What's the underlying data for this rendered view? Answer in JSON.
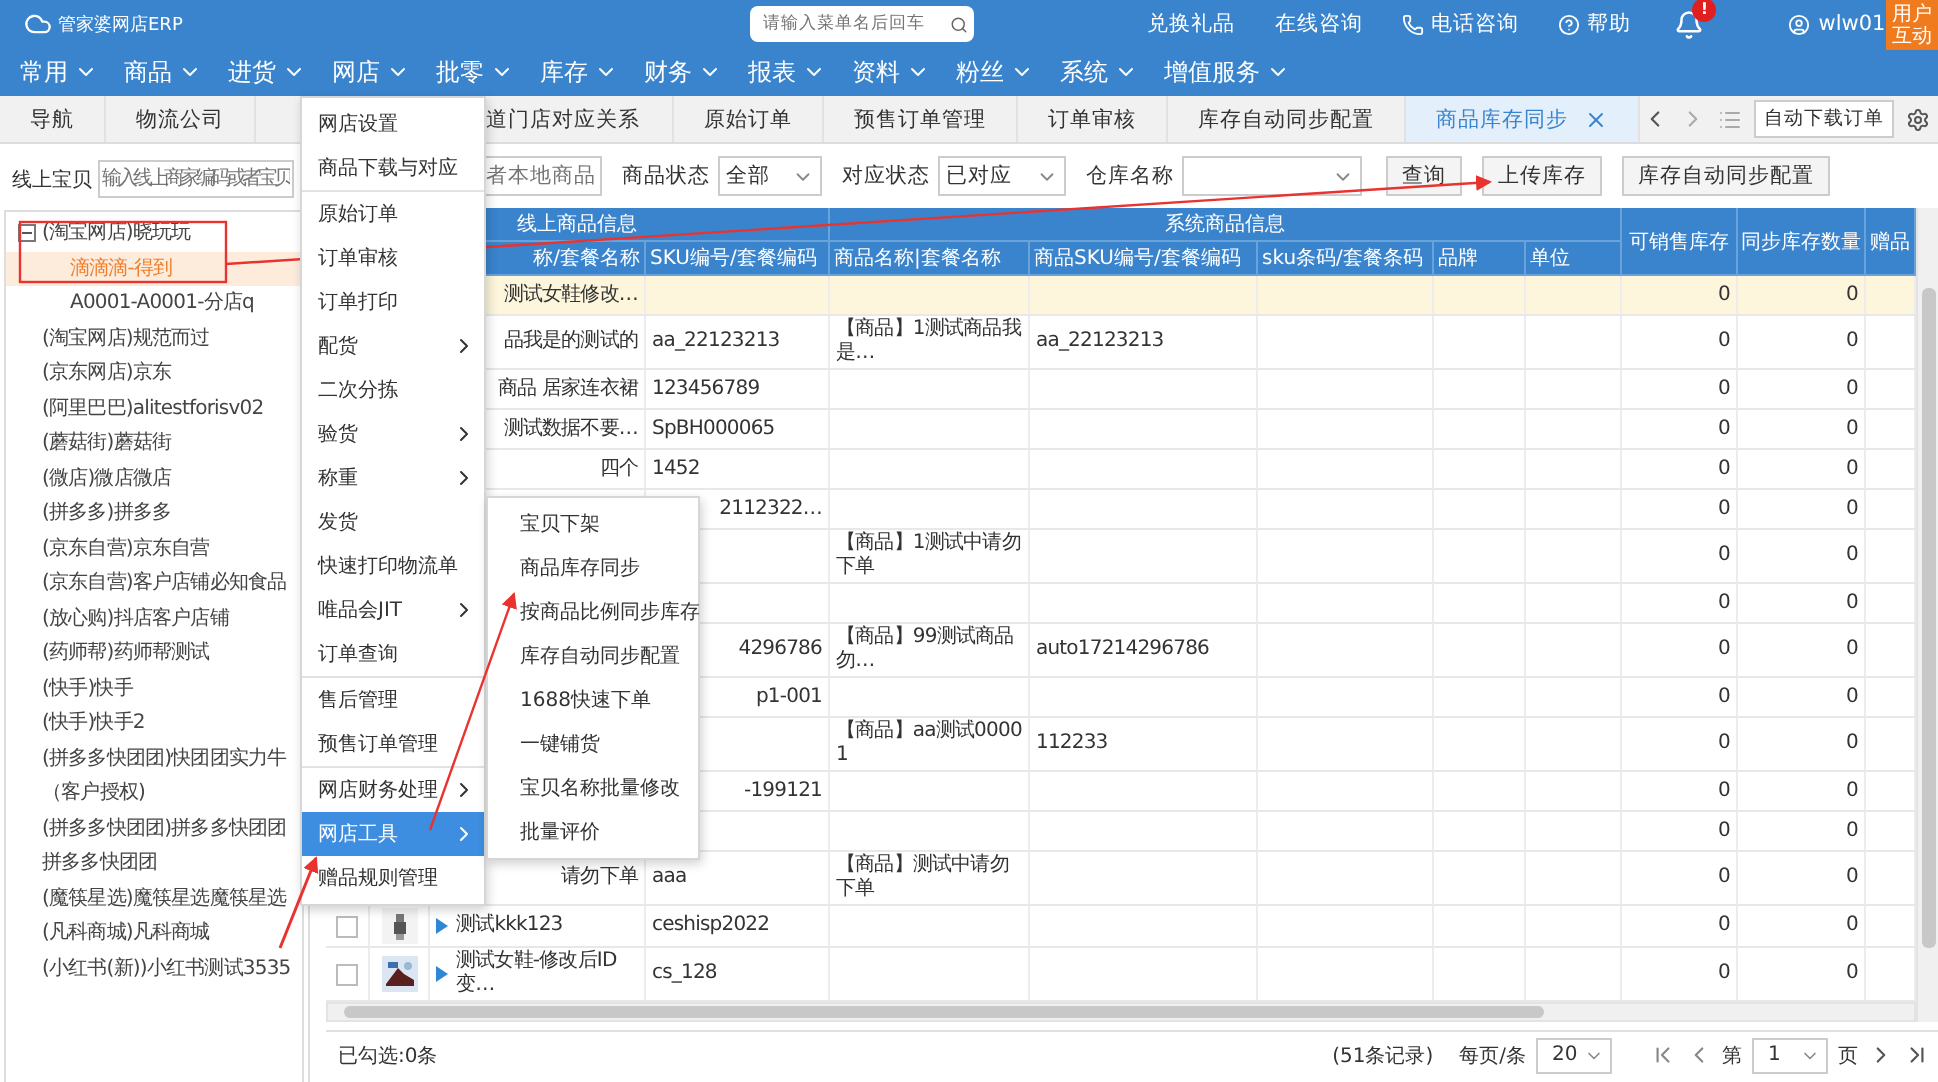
{
  "header": {
    "logo": "管家婆网店ERP",
    "search": {
      "placeholder": "请输入菜单名后回车"
    },
    "links": [
      {
        "kind": "plain",
        "label": "兑换礼品"
      },
      {
        "kind": "plain",
        "label": "在线咨询"
      },
      {
        "kind": "phone",
        "label": "电话咨询"
      },
      {
        "kind": "help",
        "label": "帮助"
      }
    ],
    "notification_badge": "!",
    "user": "wlw01",
    "feedback_button": "用户互动"
  },
  "nav": [
    "常用",
    "商品",
    "进货",
    "网店",
    "批零",
    "库存",
    "财务",
    "报表",
    "资料",
    "粉丝",
    "系统",
    "增值服务"
  ],
  "tabs": [
    {
      "label": "导航",
      "selected": false
    },
    {
      "label": "物流公司",
      "selected": false
    },
    {
      "label": "道门店对应关系",
      "selected": false,
      "clipped": true
    },
    {
      "label": "原始订单",
      "selected": false
    },
    {
      "label": "预售订单管理",
      "selected": false
    },
    {
      "label": "订单审核",
      "selected": false
    },
    {
      "label": "库存自动同步配置",
      "selected": false
    },
    {
      "label": "商品库存同步",
      "selected": true
    }
  ],
  "tab_tools": {
    "auto_download_button": "自动下载订单"
  },
  "left_panel": {
    "label": "线上宝贝",
    "search_placeholder": "输入线上商家编码或者宝贝",
    "tree": [
      {
        "label": "(淘宝网店)晓玩玩",
        "expanded": true,
        "selected": false,
        "children": [
          {
            "label": "滴滴滴-得到",
            "selected": true
          },
          {
            "label": "A0001-A0001-分店q",
            "selected": false
          }
        ]
      },
      {
        "label": "(淘宝网店)规范而过",
        "selected": false
      },
      {
        "label": "(京东网店)京东",
        "selected": false
      },
      {
        "label": "(阿里巴巴)alitestforisv02",
        "selected": false
      },
      {
        "label": "(蘑菇街)蘑菇街",
        "selected": false
      },
      {
        "label": "(微店)微店微店",
        "selected": false
      },
      {
        "label": "(拼多多)拼多多",
        "selected": false
      },
      {
        "label": "(京东自营)京东自营",
        "selected": false
      },
      {
        "label": "(京东自营)客户店铺必知食品",
        "selected": false
      },
      {
        "label": "(放心购)抖店客户店铺",
        "selected": false
      },
      {
        "label": "(药师帮)药师帮测试",
        "selected": false
      },
      {
        "label": "(快手)快手",
        "selected": false
      },
      {
        "label": "(快手)快手2",
        "selected": false
      },
      {
        "label": "(拼多多快团团)快团团实力牛（客户授权)",
        "selected": false
      },
      {
        "label": "(拼多多快团团)拼多多快团团拼多多快团团",
        "selected": false
      },
      {
        "label": "(魔筷星选)魔筷星选魔筷星选",
        "selected": false
      },
      {
        "label": "(凡科商城)凡科商城",
        "selected": false
      },
      {
        "label": "(小红书(新))小红书测试3535",
        "selected": false
      }
    ]
  },
  "filters": {
    "search_placeholder": "者本地商品",
    "selects": [
      {
        "label": "商品状态",
        "value": "全部"
      },
      {
        "label": "对应状态",
        "value": "已对应"
      },
      {
        "label": "仓库名称"
      }
    ],
    "buttons": [
      "查询",
      "上传库存",
      "库存自动同步配置"
    ]
  },
  "table": {
    "online_group": {
      "label": "线上商品信息",
      "columns": [
        {
          "label": "称/套餐名称",
          "clipped": true
        },
        {
          "label": "SKU编号/套餐编码"
        }
      ]
    },
    "system_group": {
      "label": "系统商品信息",
      "columns": [
        "商品名称|套餐名称",
        "商品SKU编号/套餐编码",
        "sku条码/套餐条码",
        "品牌",
        "单位"
      ]
    },
    "stock_columns": [
      "可销售库存",
      "同步库存数量",
      "赠品"
    ],
    "rows": [
      {
        "selected": true,
        "name": {
          "text": "测试女鞋修改…",
          "clipped": true
        },
        "sellable": "0",
        "sync": "0"
      },
      {
        "selected": false,
        "name": {
          "text": "品我是的测试的",
          "clipped": true
        },
        "sku": {
          "text": "aa_22123213"
        },
        "sys_name": "【商品】1测试商品我是…",
        "sys_sku": "aa_22123213",
        "sellable": "0",
        "sync": "0"
      },
      {
        "selected": false,
        "name": {
          "text": "商品 居家连衣裙",
          "clipped": true
        },
        "sku": {
          "text": "123456789"
        },
        "sellable": "0",
        "sync": "0"
      },
      {
        "selected": false,
        "name": {
          "text": "测试数据不要…",
          "clipped": true
        },
        "sku": {
          "text": "SpBH000065"
        },
        "sellable": "0",
        "sync": "0"
      },
      {
        "selected": false,
        "name": {
          "text": "四个",
          "clipped": true
        },
        "sku": {
          "text": "1452"
        },
        "sellable": "0",
        "sync": "0"
      },
      {
        "selected": false,
        "sku": {
          "text": "2112322…",
          "clipped": true
        },
        "sellable": "0",
        "sync": "0"
      },
      {
        "selected": false,
        "sys_name": "【商品】1测试中请勿下单",
        "sellable": "0",
        "sync": "0"
      },
      {
        "selected": false,
        "sellable": "0",
        "sync": "0"
      },
      {
        "selected": false,
        "sku": {
          "text": "4296786",
          "clipped": true
        },
        "sys_name": "【商品】99测试商品勿…",
        "sys_sku": "auto17214296786",
        "sellable": "0",
        "sync": "0"
      },
      {
        "selected": false,
        "sku": {
          "text": "p1-001",
          "clipped": true
        },
        "sellable": "0",
        "sync": "0"
      },
      {
        "selected": false,
        "sys_name": "【商品】aa测试00001",
        "sys_sku": "112233",
        "sellable": "0",
        "sync": "0"
      },
      {
        "selected": false,
        "sku": {
          "text": "-199121",
          "clipped": true
        },
        "sellable": "0",
        "sync": "0"
      },
      {
        "selected": false,
        "sellable": "0",
        "sync": "0"
      },
      {
        "selected": false,
        "name": {
          "text": "请勿下单",
          "clipped": true
        },
        "sku": {
          "text": "aaa"
        },
        "sys_name": "【商品】测试中请勿下单",
        "sellable": "0",
        "sync": "0"
      },
      {
        "selected": false,
        "checked": false,
        "expanded": false,
        "name": {
          "text": "测试kkk123"
        },
        "sku": {
          "text": "ceshisp2022"
        },
        "sellable": "0",
        "sync": "0"
      },
      {
        "selected": false,
        "checked": false,
        "expanded": false,
        "name": {
          "text": "测试女鞋-修改后ID变…"
        },
        "sku": {
          "text": "cs_128"
        },
        "sellable": "0",
        "sync": "0"
      }
    ]
  },
  "footer": {
    "selected_count": "已勾选:0条",
    "records": "(51条记录)",
    "per_page_label": "每页/条",
    "per_page": "20",
    "page_prefix": "第",
    "page": "1",
    "page_suffix": "页"
  },
  "dropdown": {
    "groups": [
      [
        {
          "label": "网店设置",
          "has_submenu": false,
          "selected": false
        },
        {
          "label": "商品下载与对应",
          "has_submenu": false,
          "selected": false
        }
      ],
      [
        {
          "label": "原始订单",
          "has_submenu": false,
          "selected": false
        },
        {
          "label": "订单审核",
          "has_submenu": false,
          "selected": false
        },
        {
          "label": "订单打印",
          "has_submenu": false,
          "selected": false
        },
        {
          "label": "配货",
          "has_submenu": true,
          "selected": false
        },
        {
          "label": "二次分拣",
          "has_submenu": false,
          "selected": false
        },
        {
          "label": "验货",
          "has_submenu": true,
          "selected": false
        },
        {
          "label": "称重",
          "has_submenu": true,
          "selected": false
        },
        {
          "label": "发货",
          "has_submenu": false,
          "selected": false
        },
        {
          "label": "快速打印物流单",
          "has_submenu": false,
          "selected": false
        },
        {
          "label": "唯品会JIT",
          "has_submenu": true,
          "selected": false
        },
        {
          "label": "订单查询",
          "has_submenu": false,
          "selected": false
        }
      ],
      [
        {
          "label": "售后管理",
          "has_submenu": false,
          "selected": false
        },
        {
          "label": "预售订单管理",
          "has_submenu": false,
          "selected": false
        }
      ],
      [
        {
          "label": "网店财务处理",
          "has_submenu": true,
          "selected": false
        },
        {
          "label": "网店工具",
          "has_submenu": true,
          "selected": true
        },
        {
          "label": "赠品规则管理",
          "has_submenu": false,
          "selected": false
        }
      ]
    ]
  },
  "submenu": {
    "items": [
      "宝贝下架",
      "商品库存同步",
      "按商品比例同步库存",
      "库存自动同步配置",
      "1688快速下单",
      "一键铺货",
      "宝贝名称批量修改",
      "批量评价"
    ]
  }
}
